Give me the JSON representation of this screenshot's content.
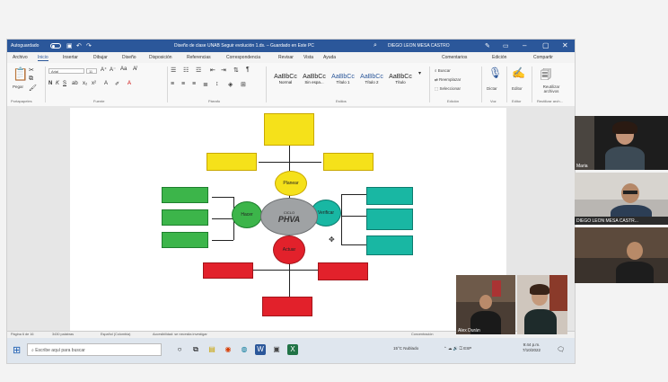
{
  "window": {
    "autosave_label": "Autoguardado",
    "doc_title": "Diseño de clase UNAB Seguir evolución 1.ds. – Guardado en Este PC",
    "user_name": "DIEGO LEON MESA CASTRO"
  },
  "ribbon": {
    "tabs": [
      "Archivo",
      "Inicio",
      "Insertar",
      "Dibujar",
      "Diseño",
      "Disposición",
      "Referencias",
      "Correspondencia",
      "Revisar",
      "Vista",
      "Ayuda"
    ],
    "active_tab": "Inicio",
    "comments_label": "Comentarios",
    "edit_label": "Edición",
    "share_label": "Compartir",
    "paste_label": "Pegar",
    "font_name": "Arial",
    "font_size": "11",
    "styles": [
      {
        "sample": "AaBbCc",
        "name": "Normal"
      },
      {
        "sample": "AaBbCc",
        "name": "Sin espa..."
      },
      {
        "sample": "AaBbCc",
        "name": "Título 1"
      },
      {
        "sample": "AaBbCc",
        "name": "Título 2"
      },
      {
        "sample": "AaBbCc",
        "name": "Título"
      }
    ],
    "find_label": "Buscar",
    "replace_label": "Reemplazar",
    "select_label": "Seleccionar",
    "dictate_label": "Dictar",
    "editor_label": "Editor",
    "reuse_label": "Reutilizar archivos",
    "groups": [
      "Portapapeles",
      "Fuente",
      "Párrafo",
      "Estilos",
      "Edición",
      "Voz",
      "Editor",
      "Reutilizar arch..."
    ]
  },
  "diagram": {
    "center_small": "CICLO",
    "center_label": "PHVA",
    "planear_label": "Planear",
    "hacer_label": "Hacer",
    "verificar_label": "Verificar",
    "actuar_label": "Actuar"
  },
  "statusbar": {
    "page": "Página 6 de 16",
    "words": "3430 palabras",
    "lang": "Español (Colombia)",
    "accessibility": "Accesibilidad: se necesita investigar",
    "focus": "Concentración"
  },
  "taskbar": {
    "search_placeholder": "Escribe aquí para buscar",
    "weather": "15°C Nublado",
    "time": "9:44 p.m.",
    "date": "7/10/2022"
  },
  "participants": [
    {
      "name": "Maria"
    },
    {
      "name": "DIEGO LEON MESA CASTR..."
    },
    {
      "name": ""
    },
    {
      "name": "Alex Durán"
    },
    {
      "name": ""
    }
  ]
}
